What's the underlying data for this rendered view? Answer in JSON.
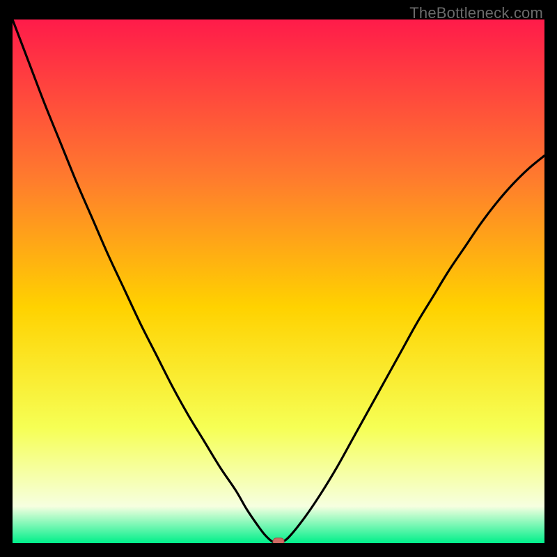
{
  "watermark": "TheBottleneck.com",
  "colors": {
    "gradient_top": "#ff1b4a",
    "gradient_mid_upper": "#ff7a2e",
    "gradient_mid": "#ffd200",
    "gradient_mid_lower": "#f6ff55",
    "gradient_pale": "#f6ffe0",
    "gradient_green": "#00ef8a",
    "curve": "#000000",
    "marker_fill": "#cf6a63",
    "marker_stroke": "#a24f49"
  },
  "chart_data": {
    "type": "line",
    "title": "",
    "xlabel": "",
    "ylabel": "",
    "xlim": [
      0,
      100
    ],
    "ylim": [
      0,
      100
    ],
    "series": [
      {
        "name": "bottleneck-curve",
        "x": [
          0,
          3,
          6,
          9,
          12,
          15,
          18,
          21,
          24,
          27,
          30,
          33,
          36,
          39,
          42,
          44,
          46,
          47.5,
          49,
          50.5,
          52,
          55,
          58,
          61,
          64,
          67,
          70,
          73,
          76,
          79,
          82,
          85,
          88,
          91,
          94,
          97,
          100
        ],
        "values": [
          100,
          92,
          84,
          76.5,
          69,
          62,
          55,
          48.5,
          42,
          36,
          30,
          24.5,
          19.5,
          14.5,
          10,
          6.5,
          3.5,
          1.5,
          0.2,
          0.2,
          1.2,
          5,
          9.5,
          14.5,
          20,
          25.5,
          31,
          36.5,
          42,
          47,
          52,
          56.5,
          61,
          65,
          68.5,
          71.5,
          74
        ]
      }
    ],
    "marker": {
      "x": 50,
      "y": 0.3
    },
    "annotations": []
  }
}
